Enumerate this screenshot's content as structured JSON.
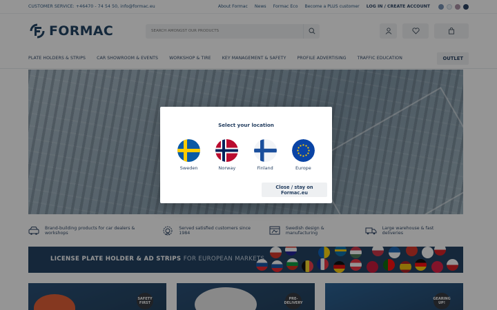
{
  "topbar": {
    "customer_service": "CUSTOMER SERVICE: +46470 - 74 54 50, info@formac.eu",
    "links": [
      "About Formac",
      "News",
      "Formac Eco",
      "Become a PLUS customer"
    ],
    "login": "LOG IN / CREATE ACCOUNT"
  },
  "header": {
    "logo_text": "FORMAC",
    "search_placeholder": "SEARCH AMONGST OUR PRODUCTS"
  },
  "nav": {
    "items": [
      "PLATE HOLDERS & STRIPS",
      "CAR SHOWROOM & EVENTS",
      "WORKSHOP & TIRE",
      "KEY MANAGEMENT & SAFETY",
      "PROFILE ADVERTISING",
      "TRAFFIC EDUCATION"
    ],
    "outlet": "OUTLET"
  },
  "usps": [
    {
      "icon": "car-icon",
      "text": "Brand-building products for car dealers & workshops"
    },
    {
      "icon": "badge-icon",
      "text": "Served satisfied customers since 1984"
    },
    {
      "icon": "design-icon",
      "text": "Swedish design & manufacturing"
    },
    {
      "icon": "truck-icon",
      "text": "Large warehouse & fast deliveries"
    }
  ],
  "banner": {
    "bold": "LICENSE PLATE HOLDER & AD STRIPS",
    "light": "FOR EUROPEAN MARKETS"
  },
  "cards": [
    {
      "badge": "SAFETY FIRST"
    },
    {
      "badge": "PRE- DELIVERY"
    },
    {
      "badge": "GEARING UP!"
    }
  ],
  "modal": {
    "title": "Select your location",
    "options": [
      "Sweden",
      "Norway",
      "Finland",
      "Europe"
    ],
    "close": "Close / stay on Formac.eu"
  },
  "colors": {
    "brand": "#153a5b",
    "accent": "#1f4e79"
  }
}
